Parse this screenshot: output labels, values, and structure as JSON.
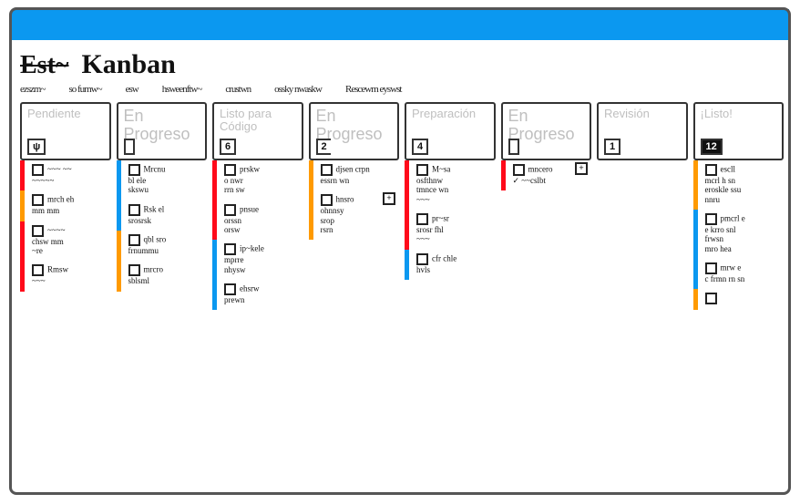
{
  "header": {
    "logo_scribble": "Est~",
    "title": "Kanban"
  },
  "nav": [
    "ezszm~",
    "so fumw~",
    "esw",
    "hsweenftw~",
    "crustwn",
    "ossky nwaskw",
    "Rescewm eyswst"
  ],
  "colors": {
    "red": "#ff0a1a",
    "orange": "#ff9a00",
    "blue": "#0b98f0"
  },
  "columns": [
    {
      "title": "Pendiente",
      "title_big": false,
      "count": "",
      "count_style": "scribble",
      "segments": [
        {
          "color": "red",
          "cards": [
            {
              "lines": [
                "~~~ ~~",
                "~~~~~"
              ]
            }
          ]
        },
        {
          "color": "orange",
          "cards": [
            {
              "lines": [
                "mrch eh",
                "mm mm"
              ]
            }
          ]
        },
        {
          "color": "red",
          "cards": [
            {
              "lines": [
                "~~~~",
                "chsw mm",
                "~re"
              ]
            },
            {
              "lines": [
                "Rmsw",
                "~~~"
              ]
            }
          ]
        }
      ]
    },
    {
      "title": "En Progreso",
      "title_big": true,
      "count": "",
      "count_style": "box",
      "segments": [
        {
          "color": "blue",
          "cards": [
            {
              "lines": [
                "Mrcnu",
                "bl ele",
                "skswu"
              ]
            },
            {
              "lines": [
                "Rsk el",
                "srosrsk"
              ]
            }
          ]
        },
        {
          "color": "orange",
          "cards": [
            {
              "lines": [
                "qbl sro",
                "frnummu"
              ]
            },
            {
              "lines": [
                "mrcro",
                "sblsml"
              ]
            }
          ]
        }
      ]
    },
    {
      "title": "Listo para Código",
      "title_big": false,
      "count": "6",
      "count_style": "box",
      "segments": [
        {
          "color": "red",
          "cards": [
            {
              "lines": [
                "prskw",
                "o nwr",
                "rrn sw"
              ]
            },
            {
              "lines": [
                "pnsue",
                "orssn",
                "orsw"
              ]
            }
          ]
        },
        {
          "color": "blue",
          "cards": [
            {
              "lines": [
                "ip~kele",
                "mprre",
                "nhysw"
              ]
            },
            {
              "lines": [
                "ehsrw",
                "prewn"
              ]
            }
          ]
        }
      ]
    },
    {
      "title": "En Progreso",
      "title_big": true,
      "count": "2",
      "count_style": "open",
      "segments": [
        {
          "color": "orange",
          "cards": [
            {
              "lines": [
                "djsen crpn",
                "essrn wn"
              ]
            },
            {
              "plus": true,
              "lines": [
                "hnsro",
                "ohnnsy",
                "srop",
                "rsrn"
              ]
            }
          ]
        }
      ]
    },
    {
      "title": "Preparación",
      "title_big": false,
      "count": "4",
      "count_style": "box",
      "segments": [
        {
          "color": "red",
          "cards": [
            {
              "lines": [
                "M~sa",
                "osfthnw",
                "tmnce wn",
                "~~~"
              ]
            },
            {
              "lines": [
                "pr~sr",
                "srosr fhl",
                "~~~"
              ]
            }
          ]
        },
        {
          "color": "blue",
          "cards": [
            {
              "lines": [
                "cfr chle",
                "hvls"
              ]
            }
          ]
        }
      ]
    },
    {
      "title": "En Progreso",
      "title_big": true,
      "count": "",
      "count_style": "box",
      "segments": [
        {
          "color": "red",
          "cards": [
            {
              "plus": true,
              "lines": [
                "mncero",
                "✓ ~~cslbt"
              ]
            }
          ]
        }
      ]
    },
    {
      "title": "Revisión",
      "title_big": false,
      "count": "1",
      "count_style": "box",
      "segments": []
    },
    {
      "title": "¡Listo!",
      "title_big": false,
      "count": "12",
      "count_style": "inv",
      "segments": [
        {
          "color": "orange",
          "cards": [
            {
              "lines": [
                "escll",
                "mcrl h sn",
                "eroskle ssu",
                "nnru"
              ]
            }
          ]
        },
        {
          "color": "blue",
          "cards": [
            {
              "lines": [
                "pmcrl e",
                "e krro snl",
                "frwsn",
                "mro hea"
              ]
            },
            {
              "lines": [
                "mrw e",
                "c frmn rn  sn"
              ]
            }
          ]
        },
        {
          "color": "orange",
          "cards": [
            {
              "lines": [
                ""
              ]
            }
          ]
        }
      ]
    }
  ]
}
